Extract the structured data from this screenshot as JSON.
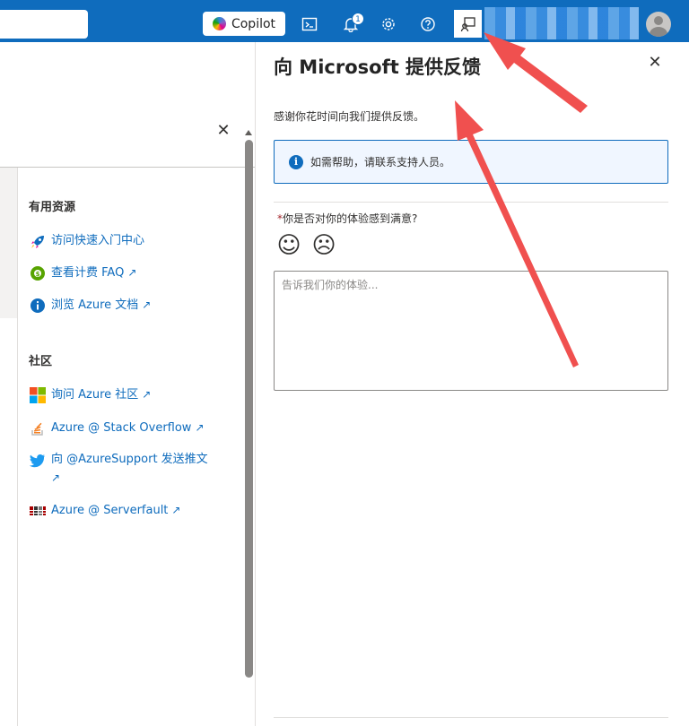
{
  "topbar": {
    "copilot_label": "Copilot",
    "notification_count": "1",
    "icons": [
      "cloud-shell-icon",
      "notification-bell-icon",
      "settings-gear-icon",
      "help-question-icon",
      "feedback-icon",
      "avatar"
    ],
    "accent_color": "#0f6cbd"
  },
  "left_panel": {
    "sections": {
      "resources": {
        "title": "有用资源",
        "links": [
          {
            "label": "访问快速入门中心",
            "icon": "rocket-icon",
            "external": false
          },
          {
            "label": "查看计费 FAQ",
            "icon": "billing-icon",
            "external": true
          },
          {
            "label": "浏览 Azure 文档",
            "icon": "info-icon",
            "external": true
          }
        ]
      },
      "community": {
        "title": "社区",
        "links": [
          {
            "label": "询问 Azure 社区",
            "icon": "microsoft-logo-icon",
            "external": true
          },
          {
            "label": "Azure @ Stack Overflow",
            "icon": "stack-overflow-icon",
            "external": true
          },
          {
            "label": "向 @AzureSupport 发送推文",
            "icon": "twitter-bird-icon",
            "external": true
          },
          {
            "label": "Azure @ Serverfault",
            "icon": "serverfault-icon",
            "external": true
          }
        ]
      }
    }
  },
  "feedback_panel": {
    "title": "向 Microsoft 提供反馈",
    "thanks_text": "感谢你花时间向我们提供反馈。",
    "info_text": "如需帮助，请联系支持人员。",
    "question_required_mark": "*",
    "question_text": "你是否对你的体验感到满意?",
    "happy_glyph": "☺",
    "sad_glyph": "☹",
    "textarea_placeholder": "告诉我们你的体验...",
    "textarea_value": ""
  },
  "glyphs": {
    "close": "✕",
    "external": "↗",
    "info": "i"
  }
}
